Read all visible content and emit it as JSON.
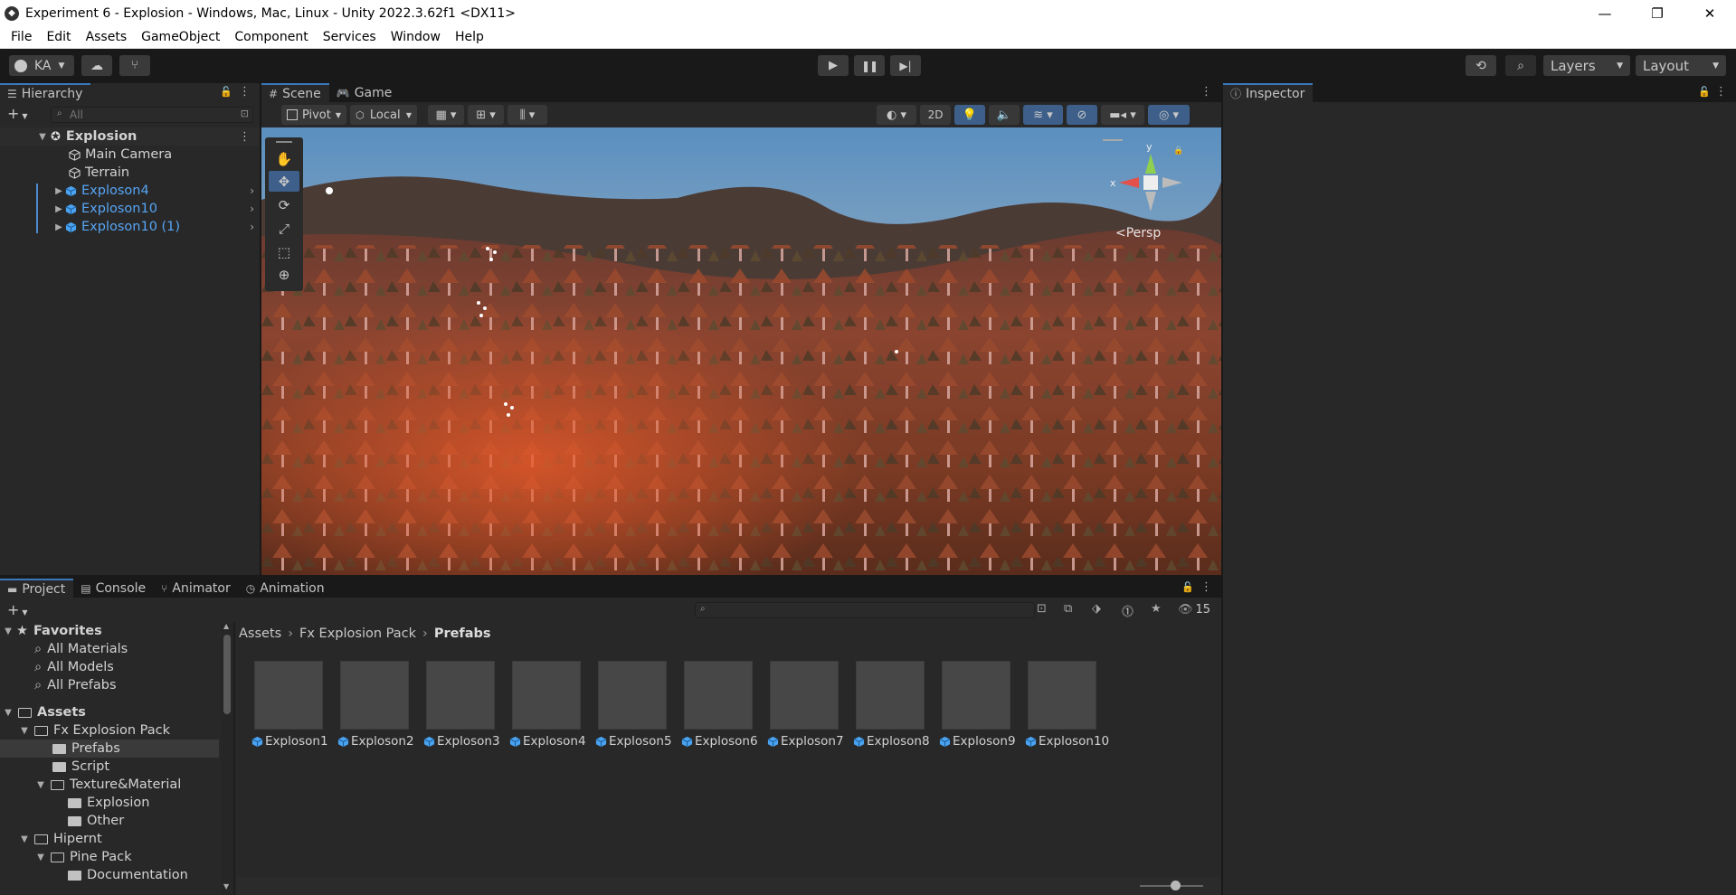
{
  "window": {
    "title": "Experiment 6 - Explosion - Windows, Mac, Linux - Unity 2022.3.62f1 <DX11>",
    "minimize": "—",
    "maximize": "❐",
    "close": "✕"
  },
  "menu": [
    "File",
    "Edit",
    "Assets",
    "GameObject",
    "Component",
    "Services",
    "Window",
    "Help"
  ],
  "toolbar": {
    "account": "KA",
    "layers": "Layers",
    "layout": "Layout"
  },
  "hierarchy": {
    "tab": "Hierarchy",
    "search_placeholder": "All",
    "scene": "Explosion",
    "items": [
      {
        "label": "Main Camera",
        "prefab": false
      },
      {
        "label": "Terrain",
        "prefab": false
      },
      {
        "label": "Exploson4",
        "prefab": true
      },
      {
        "label": "Exploson10",
        "prefab": true
      },
      {
        "label": "Exploson10 (1)",
        "prefab": true
      }
    ]
  },
  "scene_view": {
    "tabs": [
      "Scene",
      "Game"
    ],
    "pivot": "Pivot",
    "local": "Local",
    "mode_2d": "2D",
    "persp": "Persp",
    "axis_y": "y",
    "axis_x": "x"
  },
  "inspector": {
    "tab": "Inspector"
  },
  "bottom_tabs": [
    "Project",
    "Console",
    "Animator",
    "Animation"
  ],
  "project": {
    "hidden_count": "15",
    "favorites_label": "Favorites",
    "favorites": [
      "All Materials",
      "All Models",
      "All Prefabs"
    ],
    "assets_label": "Assets",
    "tree": [
      {
        "label": "Fx Explosion Pack",
        "depth": 1
      },
      {
        "label": "Prefabs",
        "depth": 2
      },
      {
        "label": "Script",
        "depth": 2
      },
      {
        "label": "Texture&Material",
        "depth": 2
      },
      {
        "label": "Explosion",
        "depth": 3
      },
      {
        "label": "Other",
        "depth": 3
      },
      {
        "label": "Hipernt",
        "depth": 1
      },
      {
        "label": "Pine Pack",
        "depth": 2
      },
      {
        "label": "Documentation",
        "depth": 3
      }
    ],
    "breadcrumb": [
      "Assets",
      "Fx Explosion Pack",
      "Prefabs"
    ],
    "assets": [
      "Exploson1",
      "Exploson2",
      "Exploson3",
      "Exploson4",
      "Exploson5",
      "Exploson6",
      "Exploson7",
      "Exploson8",
      "Exploson9",
      "Exploson10"
    ]
  },
  "colors": {
    "accent": "#3a79bb",
    "prefab_text": "#57a5f5",
    "panel": "#282828",
    "background": "#191919"
  }
}
